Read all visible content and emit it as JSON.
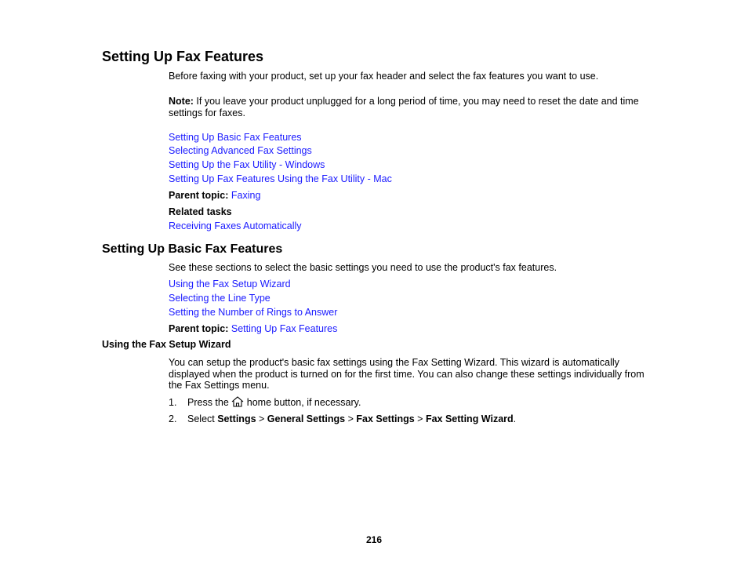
{
  "section1": {
    "title": "Setting Up Fax Features",
    "intro": "Before faxing with your product, set up your fax header and select the fax features you want to use.",
    "note_label": "Note:",
    "note_text": " If you leave your product unplugged for a long period of time, you may need to reset the date and time settings for faxes.",
    "links": [
      "Setting Up Basic Fax Features",
      "Selecting Advanced Fax Settings",
      "Setting Up the Fax Utility - Windows",
      "Setting Up Fax Features Using the Fax Utility - Mac"
    ],
    "parent_topic_label": "Parent topic:",
    "parent_topic_link": "Faxing",
    "related_tasks_label": "Related tasks",
    "related_tasks_link": "Receiving Faxes Automatically"
  },
  "section2": {
    "title": "Setting Up Basic Fax Features",
    "intro": "See these sections to select the basic settings you need to use the product's fax features.",
    "links": [
      "Using the Fax Setup Wizard",
      "Selecting the Line Type",
      "Setting the Number of Rings to Answer"
    ],
    "parent_topic_label": "Parent topic:",
    "parent_topic_link": "Setting Up Fax Features"
  },
  "section3": {
    "title": "Using the Fax Setup Wizard",
    "intro": "You can setup the product's basic fax settings using the Fax Setting Wizard. This wizard is automatically displayed when the product is turned on for the first time. You can also change these settings individually from the Fax Settings menu.",
    "steps": [
      {
        "num": "1.",
        "before": "Press the ",
        "icon": "home-icon",
        "after": " home button, if necessary."
      },
      {
        "num": "2.",
        "select": "Select ",
        "path": [
          "Settings",
          "General Settings",
          "Fax Settings",
          "Fax Setting Wizard"
        ],
        "sep": " > ",
        "end": "."
      }
    ]
  },
  "footer": {
    "page_number": "216"
  },
  "colors": {
    "link": "#1a1aff",
    "text": "#000000"
  }
}
